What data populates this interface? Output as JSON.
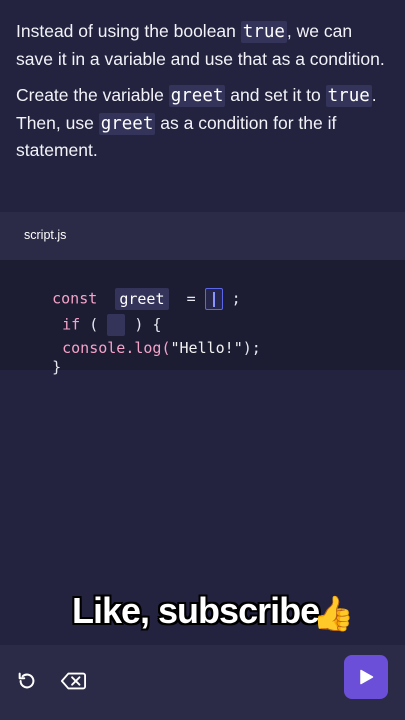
{
  "instructions": {
    "p1": {
      "t1": "Instead of using the boolean ",
      "code1": "true",
      "t2": ", we can save it in a variable and use that as a condition."
    },
    "p2": {
      "t1": "Create the variable ",
      "code1": "greet",
      "t2": " and set it to ",
      "code2": "true",
      "t3": ". Then, use ",
      "code3": "greet",
      "t4": " as a condition for the if statement."
    }
  },
  "file_tab": {
    "label": "script.js"
  },
  "code": {
    "line1": {
      "keyword": "const",
      "var_name": "greet",
      "equals": "=",
      "semicolon": ";"
    },
    "line2": {
      "keyword": "if",
      "open": "(",
      "close": ") {"
    },
    "line3": {
      "call": "console.log(",
      "string": "\"Hello!\"",
      "end": ");"
    },
    "line4": {
      "brace": "}"
    }
  },
  "overlay": {
    "caption": "Like, subscribe",
    "emoji": "👍"
  },
  "toolbar": {
    "reset_icon": "reset-icon",
    "delete_icon": "backspace-icon",
    "run_icon": "play-icon"
  },
  "colors": {
    "background": "#232340",
    "editor_background": "#1c1c33",
    "chip": "#34345a",
    "keyword": "#f4a4c8",
    "run_button": "#6c4fd8",
    "cursor_border": "#5b67e8"
  }
}
